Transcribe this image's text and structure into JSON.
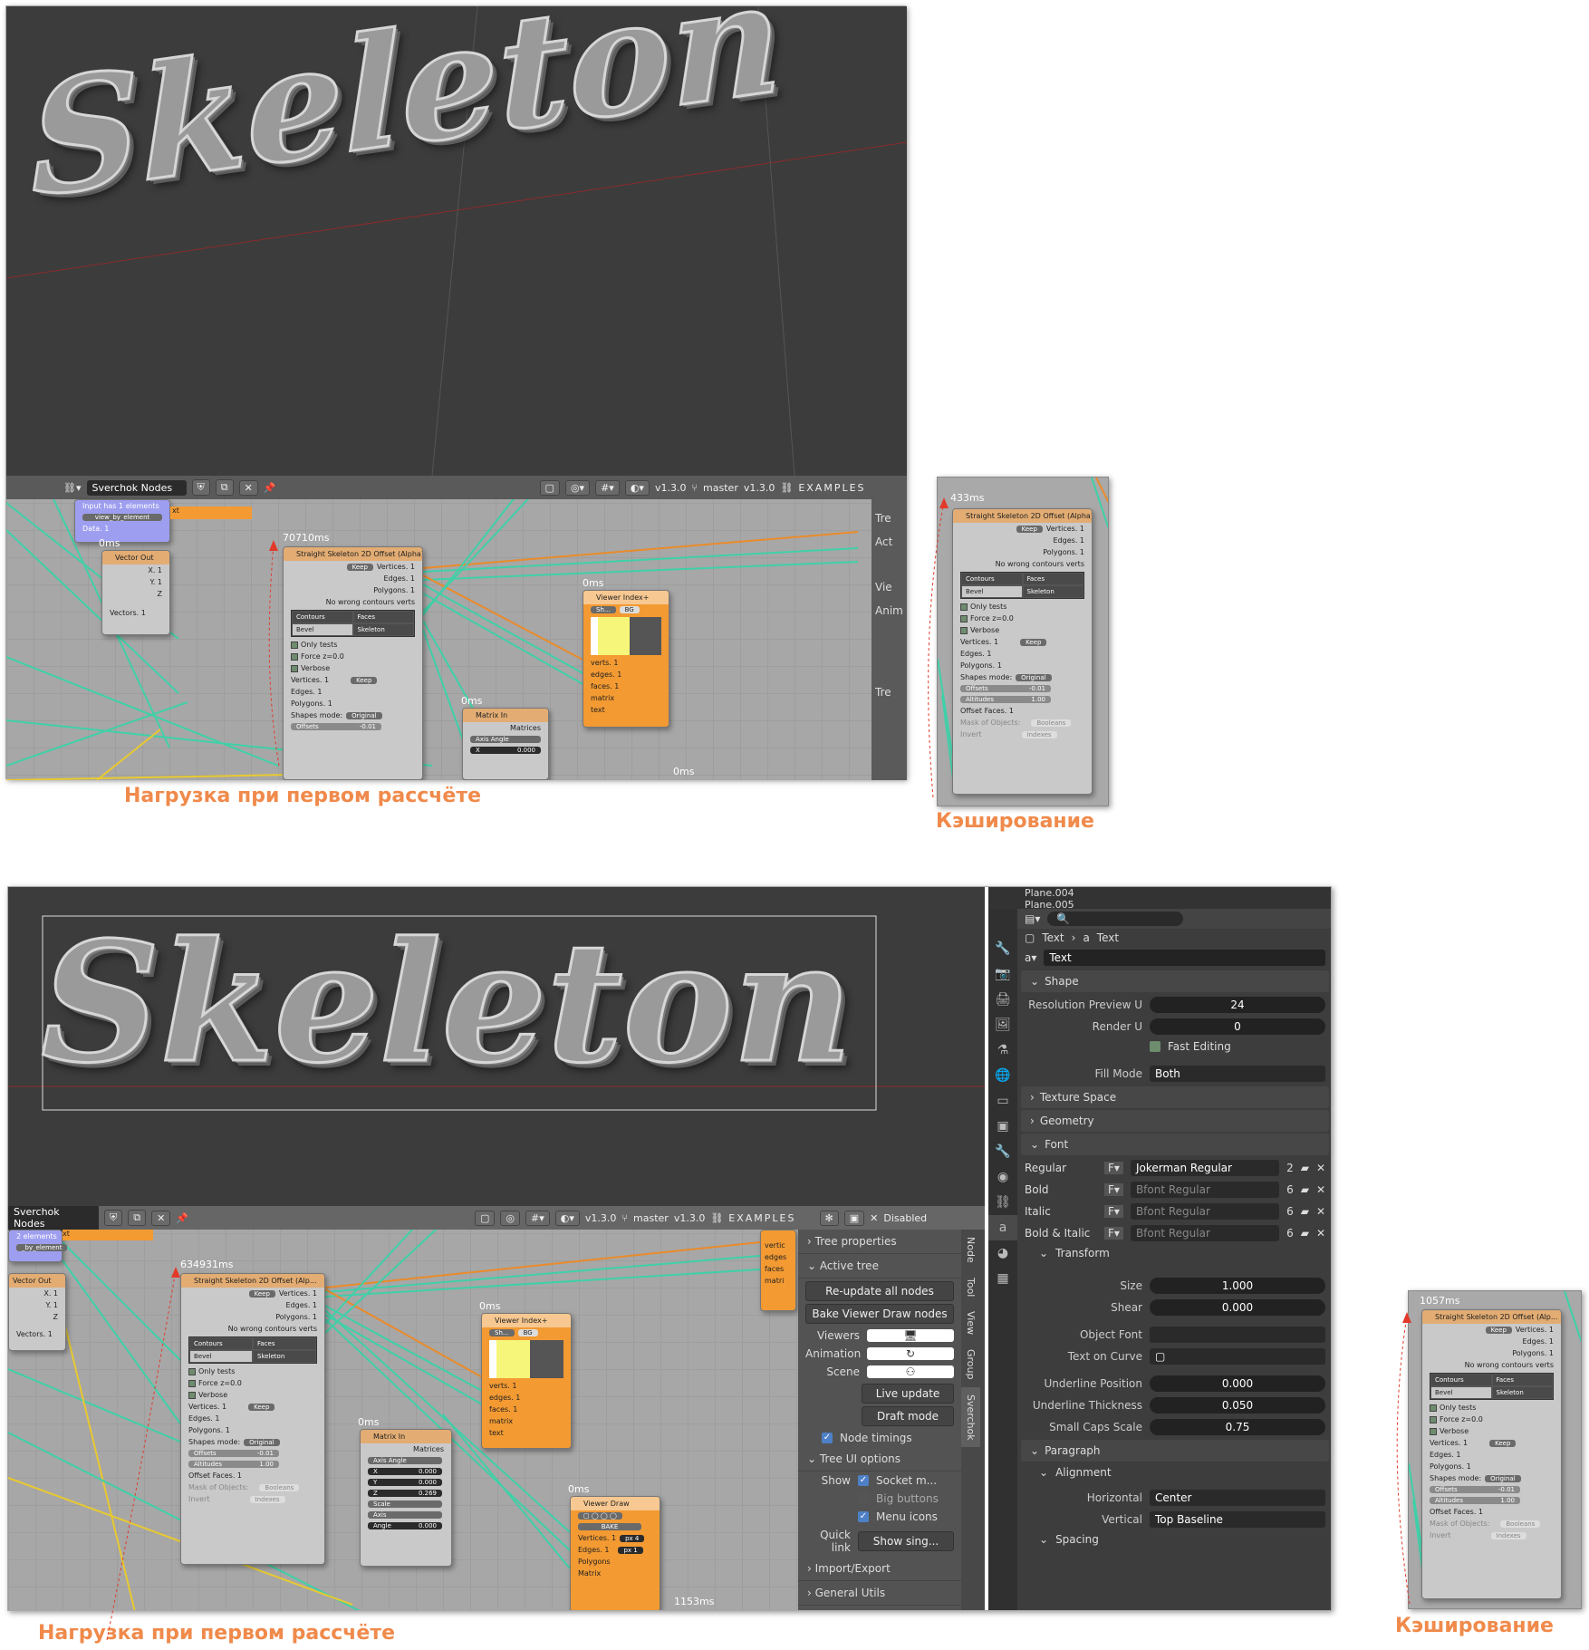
{
  "top": {
    "viewport_text": "Skeleton",
    "editor": {
      "tree_name": "Sverchok Nodes",
      "version_left": "v1.3.0",
      "branch": "master",
      "version_right": "v1.3.0",
      "examples": "EXAMPLES",
      "side_tabs": [
        "Tre",
        "Act",
        "Vie",
        "Anim",
        "Tre"
      ]
    },
    "timings": {
      "t1": "0ms",
      "t2": "70710ms",
      "t3": "0ms",
      "t4": "0ms",
      "t5": "0ms"
    },
    "blue_node": {
      "line1": "Input has 1 elements",
      "btn": "view_by_element",
      "data": "Data. 1",
      "tail": "xt"
    },
    "vector_out": {
      "title": "Vector Out",
      "x": "X. 1",
      "y": "Y. 1",
      "z": "Z",
      "out": "Vectors. 1"
    },
    "skeleton_node": {
      "title": "Straight Skeleton 2D Offset (Alpha)",
      "keep": "Keep",
      "vertices": "Vertices. 1",
      "edges": "Edges. 1",
      "polygons": "Polygons. 1",
      "no_wrong": "No wrong contours verts",
      "contours": "Contours",
      "faces": "Faces",
      "bevel": "Bevel",
      "skeleton": "Skeleton",
      "only_tests": "Only tests",
      "force_z": "Force z=0.0",
      "verbose": "Verbose",
      "in_vertices": "Vertices. 1",
      "in_edges": "Edges. 1",
      "in_polygons": "Polygons. 1",
      "shapes_mode": "Shapes mode:",
      "original": "Original",
      "offsets": "Offsets",
      "offsets_val": "-0.01"
    },
    "viewer_index": {
      "title": "Viewer Index+",
      "sh": "Sh...",
      "bg": "BG",
      "verts": "verts. 1",
      "edges": "edges. 1",
      "faces": "faces. 1",
      "matrix": "matrix",
      "text": "text"
    },
    "matrix_in": {
      "title": "Matrix In",
      "matrices": "Matrices",
      "axis_angle": "Axis Angle",
      "x": "X",
      "xval": "0.000"
    }
  },
  "top_cached": {
    "timing": "433ms",
    "title": "Straight Skeleton 2D Offset (Alpha)",
    "keep": "Keep",
    "vertices": "Vertices. 1",
    "edges": "Edges. 1",
    "polygons": "Polygons. 1",
    "no_wrong": "No wrong contours verts",
    "contours": "Contours",
    "faces": "Faces",
    "bevel": "Bevel",
    "skeleton": "Skeleton",
    "only_tests": "Only tests",
    "force_z": "Force z=0.0",
    "verbose": "Verbose",
    "in_vertices": "Vertices. 1",
    "in_edges": "Edges. 1",
    "in_polygons": "Polygons. 1",
    "shapes_mode": "Shapes mode:",
    "original": "Original",
    "offsets": "Offsets",
    "offsets_val": "-0.01",
    "altitudes": "Altitudes",
    "altitudes_val": "1.00",
    "offset_faces": "Offset Faces. 1",
    "mask": "Mask of Objects:",
    "booleans": "Booleans",
    "indexes": "Indexes",
    "invert": "Invert"
  },
  "captions": {
    "first_calc": "Нагрузка при первом рассчёте",
    "caching": "Кэширование"
  },
  "bottom": {
    "viewport_text": "Skeleton",
    "editor": {
      "tree_name": "Sverchok Nodes",
      "version_left": "v1.3.0",
      "branch": "master",
      "version_right": "v1.3.0",
      "examples": "EXAMPLES",
      "disabled": "Disabled"
    },
    "timings": {
      "t1": "634931ms",
      "t2": "0ms",
      "t3": "0ms",
      "t4": "0ms",
      "t5": "1153ms"
    },
    "blue_node": {
      "line1": "2 elements",
      "btn": "_by_element",
      "tail": "xt"
    },
    "vector_out": {
      "title": "Vector Out",
      "x": "X. 1",
      "y": "Y. 1",
      "z": "Z",
      "out": "Vectors. 1"
    },
    "skeleton_node": {
      "title": "Straight Skeleton 2D Offset (Alp...",
      "keep": "Keep",
      "vertices": "Vertices. 1",
      "edges": "Edges. 1",
      "polygons": "Polygons. 1",
      "no_wrong": "No wrong contours verts",
      "contours": "Contours",
      "faces": "Faces",
      "bevel": "Bevel",
      "skeleton": "Skeleton",
      "only_tests": "Only tests",
      "force_z": "Force z=0.0",
      "verbose": "Verbose",
      "in_vertices": "Vertices. 1",
      "in_edges": "Edges. 1",
      "in_polygons": "Polygons. 1",
      "shapes_mode": "Shapes mode:",
      "original": "Original",
      "offsets": "Offsets",
      "offsets_val": "-0.01",
      "altitudes": "Altitudes",
      "altitudes_val": "1.00",
      "offset_faces": "Offset Faces. 1",
      "mask": "Mask of Objects:",
      "booleans": "Booleans",
      "indexes": "Indexes",
      "invert": "Invert"
    },
    "viewer_index": {
      "title": "Viewer Index+",
      "sh": "Sh...",
      "bg": "BG",
      "verts": "verts. 1",
      "edges": "edges. 1",
      "faces": "faces. 1",
      "matrix": "matrix",
      "text": "text"
    },
    "matrix_in": {
      "title": "Matrix In",
      "matrices": "Matrices",
      "axis_angle": "Axis Angle",
      "x": "X",
      "xval": "0.000",
      "y": "Y",
      "yval": "0.000",
      "z": "Z",
      "zval": "0.269",
      "scale": "Scale",
      "axis": "Axis",
      "angle": "Angle",
      "angle_val": "0.000"
    },
    "viewer_draw": {
      "title": "Viewer Draw",
      "bake": "BAKE",
      "vertices": "Vertices. 1",
      "edges": "Edges. 1",
      "polygons": "Polygons",
      "matrix": "Matrix",
      "px4": "px  4",
      "px1": "px  1"
    },
    "right_col_items": [
      "vertic",
      "edges",
      "faces",
      "matri"
    ],
    "side_panel": {
      "tree_properties": "Tree properties",
      "active_tree": "Active tree",
      "reupdate": "Re-update all nodes",
      "bake": "Bake Viewer Draw nodes",
      "viewers": "Viewers",
      "animation": "Animation",
      "scene": "Scene",
      "live_update": "Live update",
      "draft_mode": "Draft mode",
      "node_timings": "Node timings",
      "tree_ui": "Tree UI options",
      "show": "Show",
      "socket": "Socket m...",
      "big_buttons": "Big buttons",
      "menu_icons": "Menu icons",
      "quick_link": "Quick link",
      "show_single": "Show sing...",
      "import_export": "Import/Export",
      "general_utils": "General Utils"
    },
    "vtabs": [
      "Node",
      "Tool",
      "View",
      "Group",
      "Sverchok"
    ],
    "outliner": [
      "Plane.004",
      "Plane.005"
    ],
    "props": {
      "breadcrumb1": "Text",
      "breadcrumb2": "Text",
      "data_name": "Text",
      "shape": "Shape",
      "res_preview": "Resolution Preview U",
      "res_preview_val": "24",
      "render_u": "Render U",
      "render_u_val": "0",
      "fast_editing": "Fast Editing",
      "fill_mode": "Fill Mode",
      "fill_mode_val": "Both",
      "texture_space": "Texture Space",
      "geometry": "Geometry",
      "font": "Font",
      "regular": "Regular",
      "regular_font": "Jokerman Regular",
      "bold": "Bold",
      "italic": "Italic",
      "bold_italic": "Bold & Italic",
      "bfont": "Bfont Regular",
      "regular_num": "2",
      "bfont_num": "6",
      "transform": "Transform",
      "size": "Size",
      "size_val": "1.000",
      "shear": "Shear",
      "shear_val": "0.000",
      "object_font": "Object Font",
      "text_on_curve": "Text on Curve",
      "underline_pos": "Underline Position",
      "underline_pos_val": "0.000",
      "underline_thick": "Underline Thickness",
      "underline_thick_val": "0.050",
      "small_caps": "Small Caps Scale",
      "small_caps_val": "0.75",
      "paragraph": "Paragraph",
      "alignment": "Alignment",
      "horizontal": "Horizontal",
      "horizontal_val": "Center",
      "vertical": "Vertical",
      "vertical_val": "Top Baseline",
      "spacing": "Spacing"
    }
  },
  "bottom_cached": {
    "timing": "1057ms",
    "title": "Straight Skeleton 2D Offset (Alp...",
    "keep": "Keep",
    "vertices": "Vertices. 1",
    "edges": "Edges. 1",
    "polygons": "Polygons. 1",
    "no_wrong": "No wrong contours verts",
    "contours": "Contours",
    "faces": "Faces",
    "bevel": "Bevel",
    "skeleton": "Skeleton",
    "only_tests": "Only tests",
    "force_z": "Force z=0.0",
    "verbose": "Verbose",
    "in_vertices": "Vertices. 1",
    "in_edges": "Edges. 1",
    "in_polygons": "Polygons. 1",
    "shapes_mode": "Shapes mode:",
    "original": "Original",
    "offsets": "Offsets",
    "offsets_val": "-0.01",
    "altitudes": "Altitudes",
    "altitudes_val": "1.00",
    "offset_faces": "Offset Faces. 1",
    "mask": "Mask of Objects:",
    "booleans": "Booleans",
    "indexes": "Indexes",
    "invert": "Invert"
  },
  "colors": {
    "caption": "#f08a4b",
    "node_header": "#e2ac73",
    "viewer_node": "#f39a32",
    "wire_green": "#3fd0a8",
    "wire_orange": "#ea8b2a"
  }
}
